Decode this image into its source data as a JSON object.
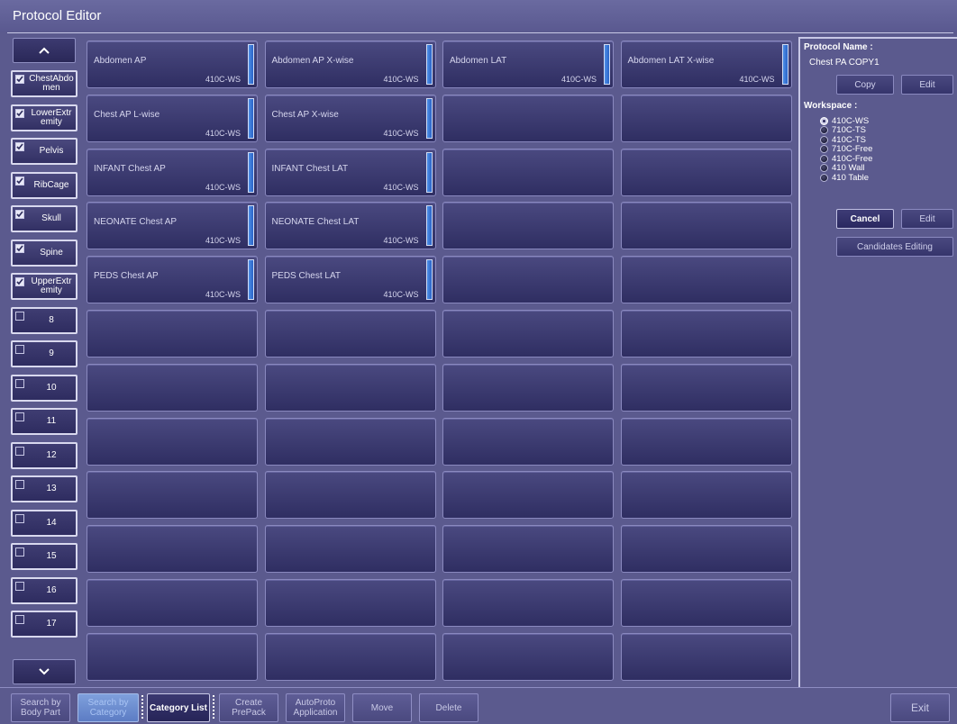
{
  "window": {
    "title": "Protocol Editor"
  },
  "categories": {
    "up_icon": "chevron-up-icon",
    "down_icon": "chevron-down-icon",
    "items": [
      {
        "label": "ChestAbdomen",
        "line1": "ChestAbdo",
        "line2": "men",
        "checked": true
      },
      {
        "label": "LowerExtremity",
        "line1": "LowerExtr",
        "line2": "emity",
        "checked": true
      },
      {
        "label": "Pelvis",
        "line1": "Pelvis",
        "line2": "",
        "checked": true
      },
      {
        "label": "RibCage",
        "line1": "RibCage",
        "line2": "",
        "checked": true
      },
      {
        "label": "Skull",
        "line1": "Skull",
        "line2": "",
        "checked": true
      },
      {
        "label": "Spine",
        "line1": "Spine",
        "line2": "",
        "checked": true
      },
      {
        "label": "UpperExtremity",
        "line1": "UpperExtr",
        "line2": "emity",
        "checked": true
      },
      {
        "label": "8",
        "line1": "8",
        "line2": "",
        "checked": false
      },
      {
        "label": "9",
        "line1": "9",
        "line2": "",
        "checked": false
      },
      {
        "label": "10",
        "line1": "10",
        "line2": "",
        "checked": false
      },
      {
        "label": "11",
        "line1": "11",
        "line2": "",
        "checked": false
      },
      {
        "label": "12",
        "line1": "12",
        "line2": "",
        "checked": false
      },
      {
        "label": "13",
        "line1": "13",
        "line2": "",
        "checked": false
      },
      {
        "label": "14",
        "line1": "14",
        "line2": "",
        "checked": false
      },
      {
        "label": "15",
        "line1": "15",
        "line2": "",
        "checked": false
      },
      {
        "label": "16",
        "line1": "16",
        "line2": "",
        "checked": false
      },
      {
        "label": "17",
        "line1": "17",
        "line2": "",
        "checked": false
      }
    ]
  },
  "protocols": {
    "columns": 4,
    "rows": 12,
    "items": [
      {
        "name": "Abdomen AP",
        "workspace": "410C-WS"
      },
      {
        "name": "Abdomen AP X-wise",
        "workspace": "410C-WS"
      },
      {
        "name": "Abdomen LAT",
        "workspace": "410C-WS"
      },
      {
        "name": "Abdomen LAT X-wise",
        "workspace": "410C-WS"
      },
      {
        "name": "Chest AP L-wise",
        "workspace": "410C-WS"
      },
      {
        "name": "Chest AP X-wise",
        "workspace": "410C-WS"
      },
      null,
      null,
      {
        "name": "INFANT Chest AP",
        "workspace": "410C-WS"
      },
      {
        "name": "INFANT Chest LAT",
        "workspace": "410C-WS"
      },
      null,
      null,
      {
        "name": "NEONATE Chest AP",
        "workspace": "410C-WS"
      },
      {
        "name": "NEONATE Chest LAT",
        "workspace": "410C-WS"
      },
      null,
      null,
      {
        "name": "PEDS Chest AP",
        "workspace": "410C-WS"
      },
      {
        "name": "PEDS Chest LAT",
        "workspace": "410C-WS"
      }
    ]
  },
  "right_panel": {
    "protocol_name_heading": "Protocol Name :",
    "protocol_name": "Chest PA COPY1",
    "copy_label": "Copy",
    "edit_label": "Edit",
    "workspace_heading": "Workspace :",
    "workspaces": [
      {
        "label": "410C-WS",
        "selected": true
      },
      {
        "label": "710C-TS",
        "selected": false
      },
      {
        "label": "410C-TS",
        "selected": false
      },
      {
        "label": "710C-Free",
        "selected": false
      },
      {
        "label": "410C-Free",
        "selected": false
      },
      {
        "label": "410 Wall",
        "selected": false
      },
      {
        "label": "410 Table",
        "selected": false
      }
    ],
    "cancel_label": "Cancel",
    "edit2_label": "Edit",
    "candidates_label": "Candidates Editing"
  },
  "toolbar": {
    "search_body_1": "Search by",
    "search_body_2": "Body Part",
    "search_cat_1": "Search by",
    "search_cat_2": "Category",
    "category_list": "Category List",
    "create_1": "Create",
    "create_2": "PrePack",
    "auto_1": "AutoProto",
    "auto_2": "Application",
    "move": "Move",
    "delete": "Delete",
    "exit": "Exit"
  },
  "colors": {
    "background": "#5b5a8e",
    "tile": "#3a3970",
    "accent_bar": "#3f7ddc",
    "active_tab": "#7391d4"
  }
}
